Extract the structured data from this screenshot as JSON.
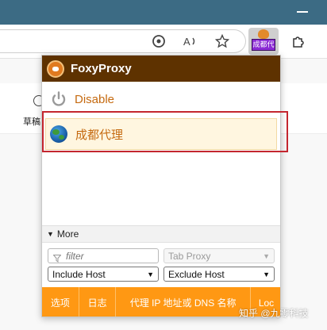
{
  "browser": {
    "address_text": "",
    "extension_badge": "成都代"
  },
  "page_bg": {
    "label": "草稿"
  },
  "popup": {
    "title": "FoxyProxy",
    "disable_label": "Disable",
    "proxy_name": "成都代理",
    "more_label": "More",
    "filter_placeholder": "filter",
    "tab_proxy_label": "Tab Proxy",
    "include_select": "Include Host",
    "exclude_select": "Exclude Host",
    "footer": [
      "选项",
      "日志",
      "代理 IP 地址或 DNS 名称",
      "Loc"
    ]
  },
  "watermark": "知乎 @九零科技",
  "colors": {
    "header": "#5e3200",
    "footer": "#ff9813",
    "accent_text": "#c56a10",
    "highlight_border": "#c4262f"
  }
}
